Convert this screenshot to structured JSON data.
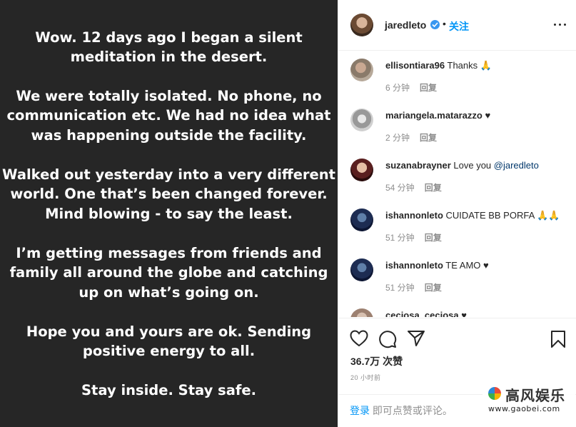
{
  "post": {
    "paragraphs": [
      "Wow. 12 days ago I began a silent\nmeditation in the desert.",
      "We were totally isolated. No phone, no\ncommunication etc. We had no idea what\nwas happening outside the facility.",
      "Walked out yesterday into a very different\nworld. One that’s been changed forever.\nMind blowing - to say the least.",
      "I’m getting messages from friends and\nfamily all around the globe and catching\nup on what’s going on.",
      "Hope you and yours are ok. Sending\npositive energy to all.",
      "Stay inside. Stay safe."
    ]
  },
  "header": {
    "username": "jaredleto",
    "dot": "•",
    "follow": "关注",
    "avatar_icon": "profile-avatar",
    "verified_icon": "verified-badge-icon",
    "more_icon": "more-options-icon"
  },
  "comments": [
    {
      "user": "ellisontiara96",
      "text": "Thanks 🙏",
      "mention": "",
      "time": "6 分钟",
      "reply": "回复"
    },
    {
      "user": "mariangela.matarazzo",
      "text": "♥",
      "mention": "",
      "time": "2 分钟",
      "reply": "回复"
    },
    {
      "user": "suzanabrayner",
      "text": "Love you",
      "mention": "@jaredleto",
      "time": "54 分钟",
      "reply": "回复"
    },
    {
      "user": "ishannonleto",
      "text": "CUIDATE BB PORFA 🙏🙏",
      "mention": "",
      "time": "51 分钟",
      "reply": "回复"
    },
    {
      "user": "ishannonleto",
      "text": "TE AMO ♥",
      "mention": "",
      "time": "51 分钟",
      "reply": "回复"
    },
    {
      "user": "ceciosa_ceciosa",
      "text": "♥",
      "mention": "",
      "time": "",
      "reply": ""
    }
  ],
  "actions": {
    "like_icon": "heart-icon",
    "comment_icon": "comment-icon",
    "share_icon": "share-icon",
    "save_icon": "bookmark-icon",
    "likes": "36.7万 次赞",
    "time": "20 小时前"
  },
  "login_bar": {
    "login": "登录",
    "text": " 即可点赞或评论。"
  },
  "watermark": {
    "name": "高风娱乐",
    "url": "www.gaobei.com"
  },
  "colors": {
    "post_bg": "#262626",
    "accent": "#0095f6",
    "verified": "#3897f0",
    "muted": "#8e8e8e",
    "mention": "#00376b"
  }
}
